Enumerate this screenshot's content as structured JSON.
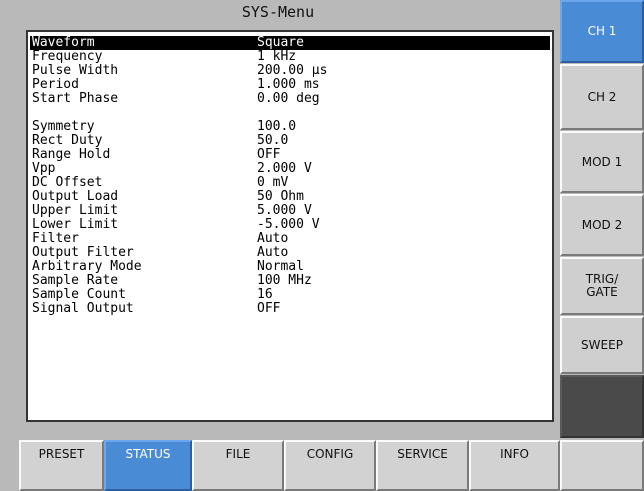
{
  "title": "SYS-Menu",
  "parameters": [
    {
      "label": "Waveform",
      "value": "Square",
      "selected": true
    },
    {
      "label": "Frequency",
      "value": "1 kHz"
    },
    {
      "label": "Pulse Width",
      "value": "200.00 µs"
    },
    {
      "label": "Period",
      "value": "1.000 ms"
    },
    {
      "label": "Start Phase",
      "value": "0.00 deg"
    },
    {
      "label": "Symmetry",
      "value": "100.0"
    },
    {
      "label": "Rect Duty",
      "value": "50.0"
    },
    {
      "label": "Range Hold",
      "value": "OFF"
    },
    {
      "label": "Vpp",
      "value": "2.000 V"
    },
    {
      "label": "DC Offset",
      "value": "0 mV"
    },
    {
      "label": "Output Load",
      "value": "50 Ohm"
    },
    {
      "label": "Upper Limit",
      "value": "5.000 V"
    },
    {
      "label": "Lower Limit",
      "value": "-5.000 V"
    },
    {
      "label": "Filter",
      "value": "Auto"
    },
    {
      "label": "Output Filter",
      "value": "Auto"
    },
    {
      "label": "Arbitrary Mode",
      "value": "Normal"
    },
    {
      "label": "Sample Rate",
      "value": "100 MHz"
    },
    {
      "label": "Sample Count",
      "value": "16"
    },
    {
      "label": "Signal Output",
      "value": "OFF"
    }
  ],
  "side_buttons": [
    {
      "label": "CH 1",
      "active": true
    },
    {
      "label": "CH 2"
    },
    {
      "label": "MOD 1"
    },
    {
      "label": "MOD 2"
    },
    {
      "label": "TRIG/\nGATE"
    },
    {
      "label": "SWEEP"
    },
    {
      "label": ""
    }
  ],
  "bottom_tabs": [
    {
      "label": "PRESET"
    },
    {
      "label": "STATUS",
      "active": true
    },
    {
      "label": "FILE"
    },
    {
      "label": "CONFIG"
    },
    {
      "label": "SERVICE"
    },
    {
      "label": "INFO"
    },
    {
      "label": ""
    }
  ],
  "colors": {
    "active": "#4a8bd6",
    "background": "#b9b9b9"
  }
}
